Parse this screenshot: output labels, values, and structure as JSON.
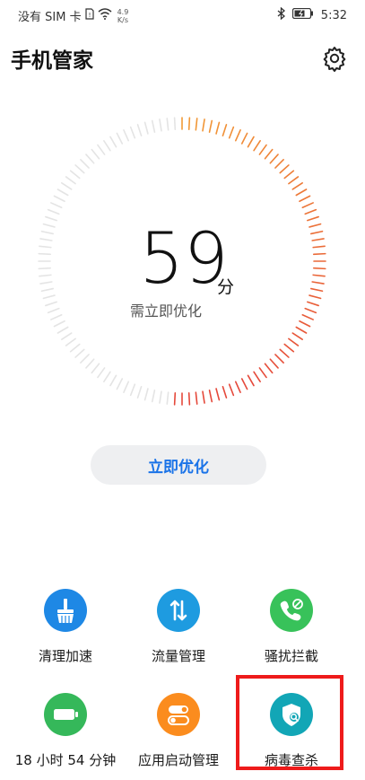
{
  "status_bar": {
    "carrier": "没有 SIM 卡",
    "net_speed_value": "4.9",
    "net_speed_unit": "K/s",
    "time": "5:32"
  },
  "header": {
    "title": "手机管家"
  },
  "score": {
    "value": "59",
    "unit": "分",
    "description": "需立即优化"
  },
  "optimize_button": {
    "label": "立即优化"
  },
  "tools": [
    {
      "label": "清理加速",
      "icon": "broom-icon",
      "color": "#1e88e5"
    },
    {
      "label": "流量管理",
      "icon": "data-traffic-icon",
      "color": "#1e9be0"
    },
    {
      "label": "骚扰拦截",
      "icon": "phone-block-icon",
      "color": "#38c25a"
    },
    {
      "label": "18 小时 54 分钟",
      "icon": "battery-icon",
      "color": "#35b85a"
    },
    {
      "label": "应用启动管理",
      "icon": "app-toggle-icon",
      "color": "#fb8c1e"
    },
    {
      "label": "病毒查杀",
      "icon": "virus-scan-shield-icon",
      "color": "#12a6b6"
    }
  ],
  "colors": {
    "accent": "#1a73e8",
    "ring_inactive": "#e4e4e4",
    "ring_orange": "#f29a36",
    "ring_red": "#e5483a",
    "highlight": "#ee1b1b"
  }
}
